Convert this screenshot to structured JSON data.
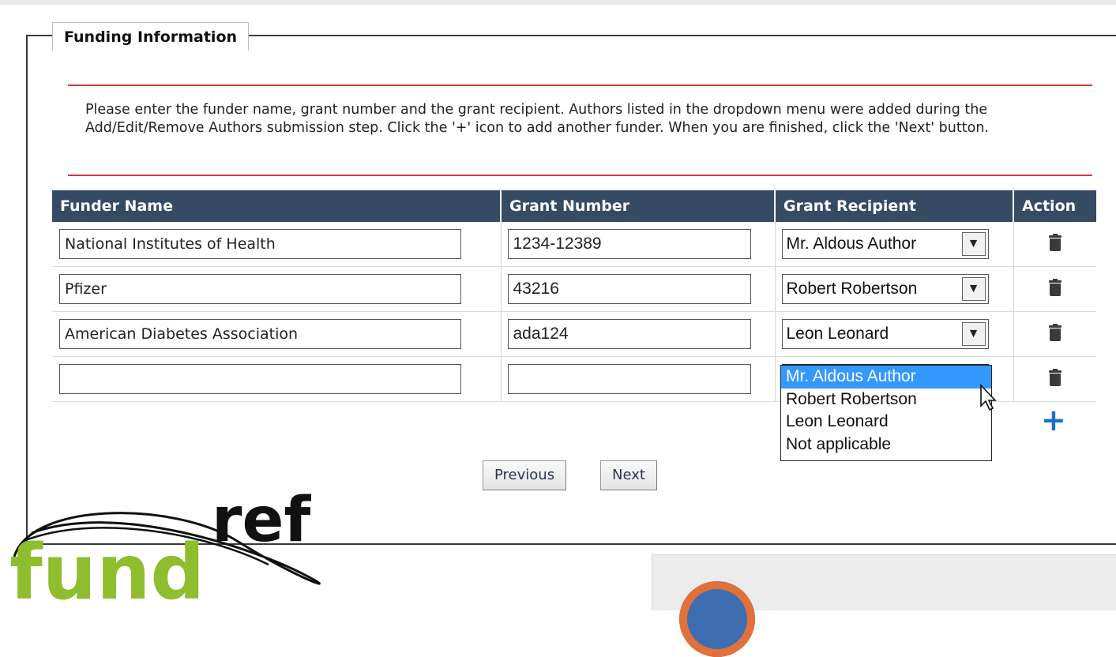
{
  "panel": {
    "legend": "Funding Information",
    "instructions": "Please enter the funder name, grant number and the grant recipient. Authors listed in the dropdown menu were added during the Add/Edit/Remove Authors submission step. Click the '+' icon to add another funder. When you are finished, click the 'Next' button."
  },
  "table": {
    "headers": [
      "Funder Name",
      "Grant Number",
      "Grant Recipient",
      "Action"
    ],
    "rows": [
      {
        "funder": "National Institutes of Health",
        "grant": "1234-12389",
        "recipient": "Mr. Aldous Author"
      },
      {
        "funder": "Pfizer",
        "grant": "43216",
        "recipient": "Robert Robertson"
      },
      {
        "funder": "American Diabetes Association",
        "grant": "ada124",
        "recipient": "Leon Leonard"
      },
      {
        "funder": "",
        "grant": "",
        "recipient": ""
      }
    ]
  },
  "dropdown": {
    "options": [
      "Mr. Aldous Author",
      "Robert Robertson",
      "Leon Leonard",
      "Not applicable"
    ],
    "highlighted": "Mr. Aldous Author"
  },
  "icons": {
    "delete": "trash-icon",
    "add": "plus-icon",
    "select_arrow": "chevron-down-icon",
    "cursor": "mouse-pointer-icon"
  },
  "buttons": {
    "previous": "Previous",
    "next": "Next",
    "add": "+"
  },
  "logo": {
    "word_fund": "fund",
    "word_ref": "ref"
  },
  "colors": {
    "header_bg": "#344b63",
    "rule": "#cc3c3c",
    "highlight": "#3399ff",
    "add_icon": "#1a73c9",
    "logo_green": "#8ebd2e"
  }
}
